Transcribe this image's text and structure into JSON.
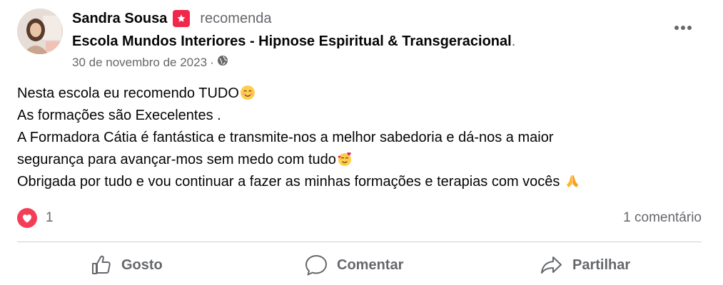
{
  "post": {
    "author_name": "Sandra Sousa",
    "action_verb": "recomenda",
    "page_name": "Escola Mundos Interiores - Hipnose Espiritual & Transgeracional",
    "page_suffix": ".",
    "date": "30 de novembro de 2023",
    "date_separator": "·",
    "privacy_icon": "globe-icon",
    "body_lines": [
      "Nesta escola eu recomendo TUDO",
      "As formações são Execelentes .",
      "A Formadora Cátia é fantástica e transmite-nos a melhor sabedoria e dá-nos a maior",
      "segurança para avançar-mos sem medo com tudo",
      "Obrigada por tudo e vou continuar a fazer as minhas formações e terapias com vocês "
    ],
    "reaction_icon": "love-reaction-icon",
    "reactions_count": "1",
    "comments_count": "1 comentário"
  },
  "actions": {
    "like_label": "Gosto",
    "comment_label": "Comentar",
    "share_label": "Partilhar"
  },
  "colors": {
    "text_primary": "#050505",
    "text_secondary": "#65676b",
    "recommend_badge": "#f02849",
    "love_reaction": "#f33e58",
    "divider": "#ced0d4"
  }
}
